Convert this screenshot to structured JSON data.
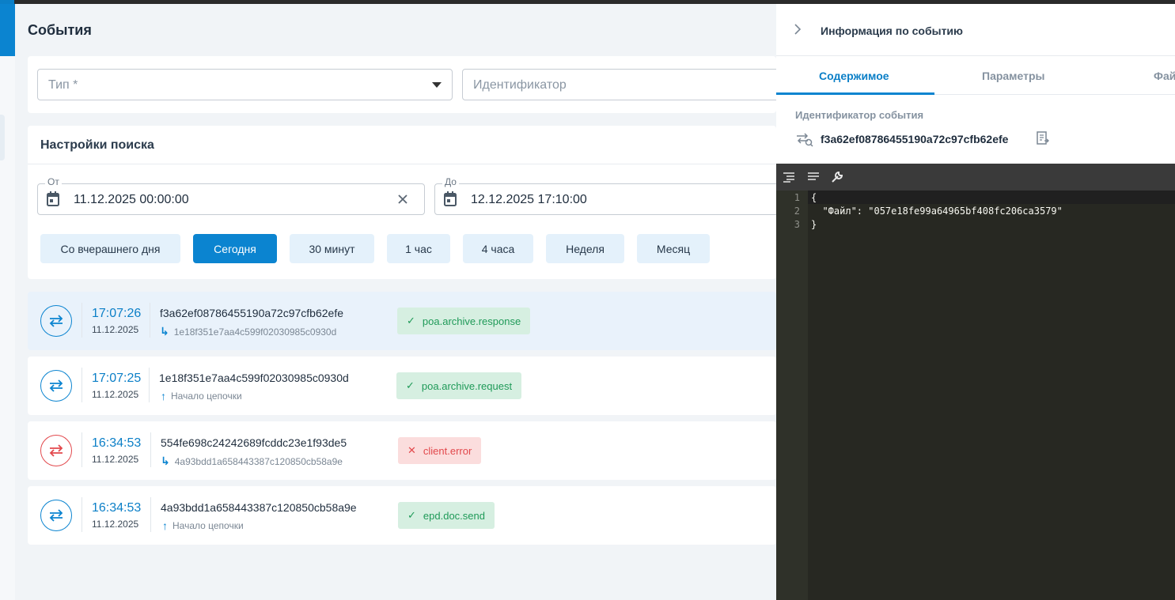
{
  "page": {
    "title": "События"
  },
  "filters": {
    "type_placeholder": "Тип *",
    "id_placeholder": "Идентификатор"
  },
  "search": {
    "title": "Настройки поиска",
    "from_label": "От",
    "from_value": "11.12.2025 00:00:00",
    "to_label": "До",
    "to_value": "12.12.2025 17:10:00",
    "quick": [
      "Со вчерашнего дня",
      "Сегодня",
      "30 минут",
      "1 час",
      "4 часа",
      "Неделя",
      "Месяц"
    ],
    "active_quick": "Сегодня"
  },
  "events": [
    {
      "time": "17:07:26",
      "date": "11.12.2025",
      "id": "f3a62ef08786455190a72c97cfb62efe",
      "sub": "1e18f351e7aa4c599f02030985c0930d",
      "sub_type": "parent",
      "status": "poa.archive.response",
      "ok": true
    },
    {
      "time": "17:07:25",
      "date": "11.12.2025",
      "id": "1e18f351e7aa4c599f02030985c0930d",
      "sub": "Начало цепочки",
      "sub_type": "chain-start",
      "status": "poa.archive.request",
      "ok": true
    },
    {
      "time": "16:34:53",
      "date": "11.12.2025",
      "id": "554fe698c24242689fcddc23e1f93de5",
      "sub": "4a93bdd1a658443387c120850cb58a9e",
      "sub_type": "parent",
      "status": "client.error",
      "ok": false
    },
    {
      "time": "16:34:53",
      "date": "11.12.2025",
      "id": "4a93bdd1a658443387c120850cb58a9e",
      "sub": "Начало цепочки",
      "sub_type": "chain-start",
      "status": "epd.doc.send",
      "ok": true
    }
  ],
  "panel": {
    "title": "Информация по событию",
    "tabs": [
      "Содержимое",
      "Параметры",
      "Фай"
    ],
    "id_label": "Идентификатор события",
    "id_value": "f3a62ef08786455190a72c97cfb62efe",
    "code_lines": [
      "{",
      "  \"Файл\": \"057e18fe99a64965bf408fc206ca3579\"",
      "}"
    ],
    "line_numbers": [
      "1",
      "2",
      "3"
    ]
  },
  "colors": {
    "accent": "#0b84d0",
    "success": "#1f9a58",
    "error": "#e2484c",
    "editor_bg": "#272822"
  }
}
